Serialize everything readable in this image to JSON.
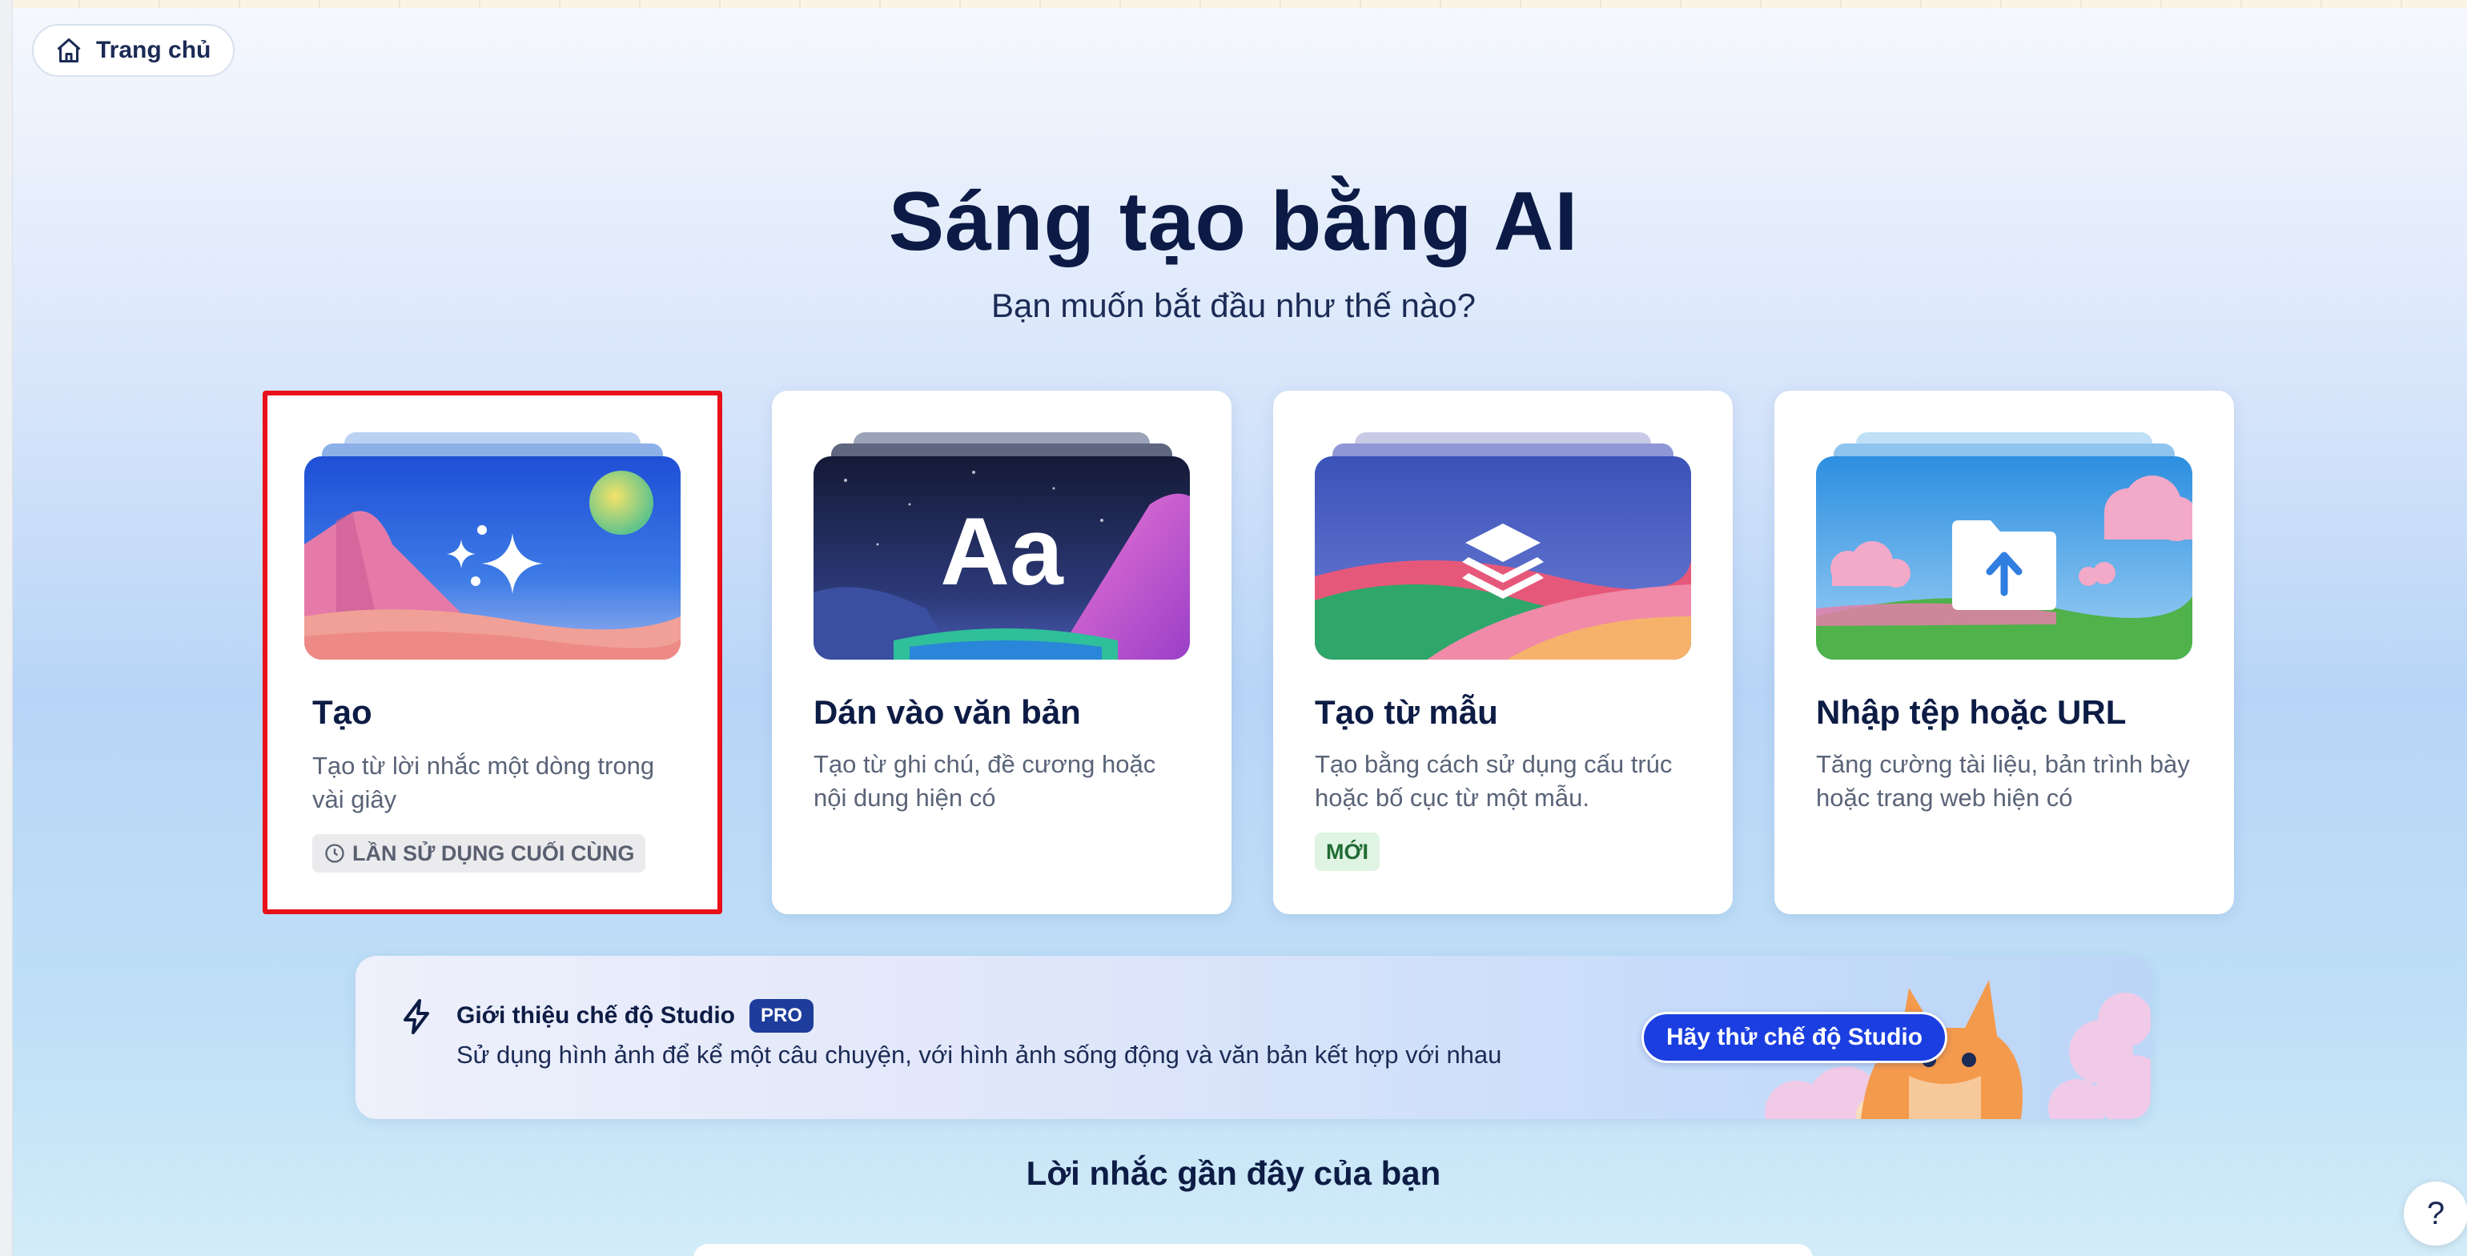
{
  "nav": {
    "home_label": "Trang chủ",
    "home_icon": "home-icon"
  },
  "hero": {
    "title": "Sáng tạo bằng AI",
    "subtitle": "Bạn muốn bắt đầu như thế nào?"
  },
  "cards": [
    {
      "title": "Tạo",
      "description": "Tạo từ lời nhắc một dòng trong vài giây",
      "badge": "LẦN SỬ DỤNG CUỐI CÙNG",
      "badge_icon": "clock-icon",
      "thumb_icon": "sparkles-icon",
      "selected": true
    },
    {
      "title": "Dán vào văn bản",
      "description": "Tạo từ ghi chú, đề cương hoặc nội dung hiện có",
      "thumb_text": "Aa"
    },
    {
      "title": "Tạo từ mẫu",
      "description": "Tạo bằng cách sử dụng cấu trúc hoặc bố cục từ một mẫu.",
      "badge": "MỚI",
      "thumb_icon": "layers-icon"
    },
    {
      "title": "Nhập tệp hoặc URL",
      "description": "Tăng cường tài liệu, bản trình bày hoặc trang web hiện có",
      "thumb_icon": "folder-upload-icon"
    }
  ],
  "studio": {
    "title": "Giới thiệu chế độ Studio",
    "pro_label": "PRO",
    "description": "Sử dụng hình ảnh để kể một câu chuyện, với hình ảnh sống động và văn bản kết hợp với nhau",
    "button_label": "Hãy thử chế độ Studio",
    "icon": "bolt-icon"
  },
  "recent": {
    "title": "Lời nhắc gần đây của bạn"
  },
  "help": {
    "label": "?"
  },
  "colors": {
    "accent": "#1a3ee0",
    "selected_border": "#e8101a",
    "heading": "#0b1b45",
    "new_badge_bg": "#dff4e2"
  }
}
